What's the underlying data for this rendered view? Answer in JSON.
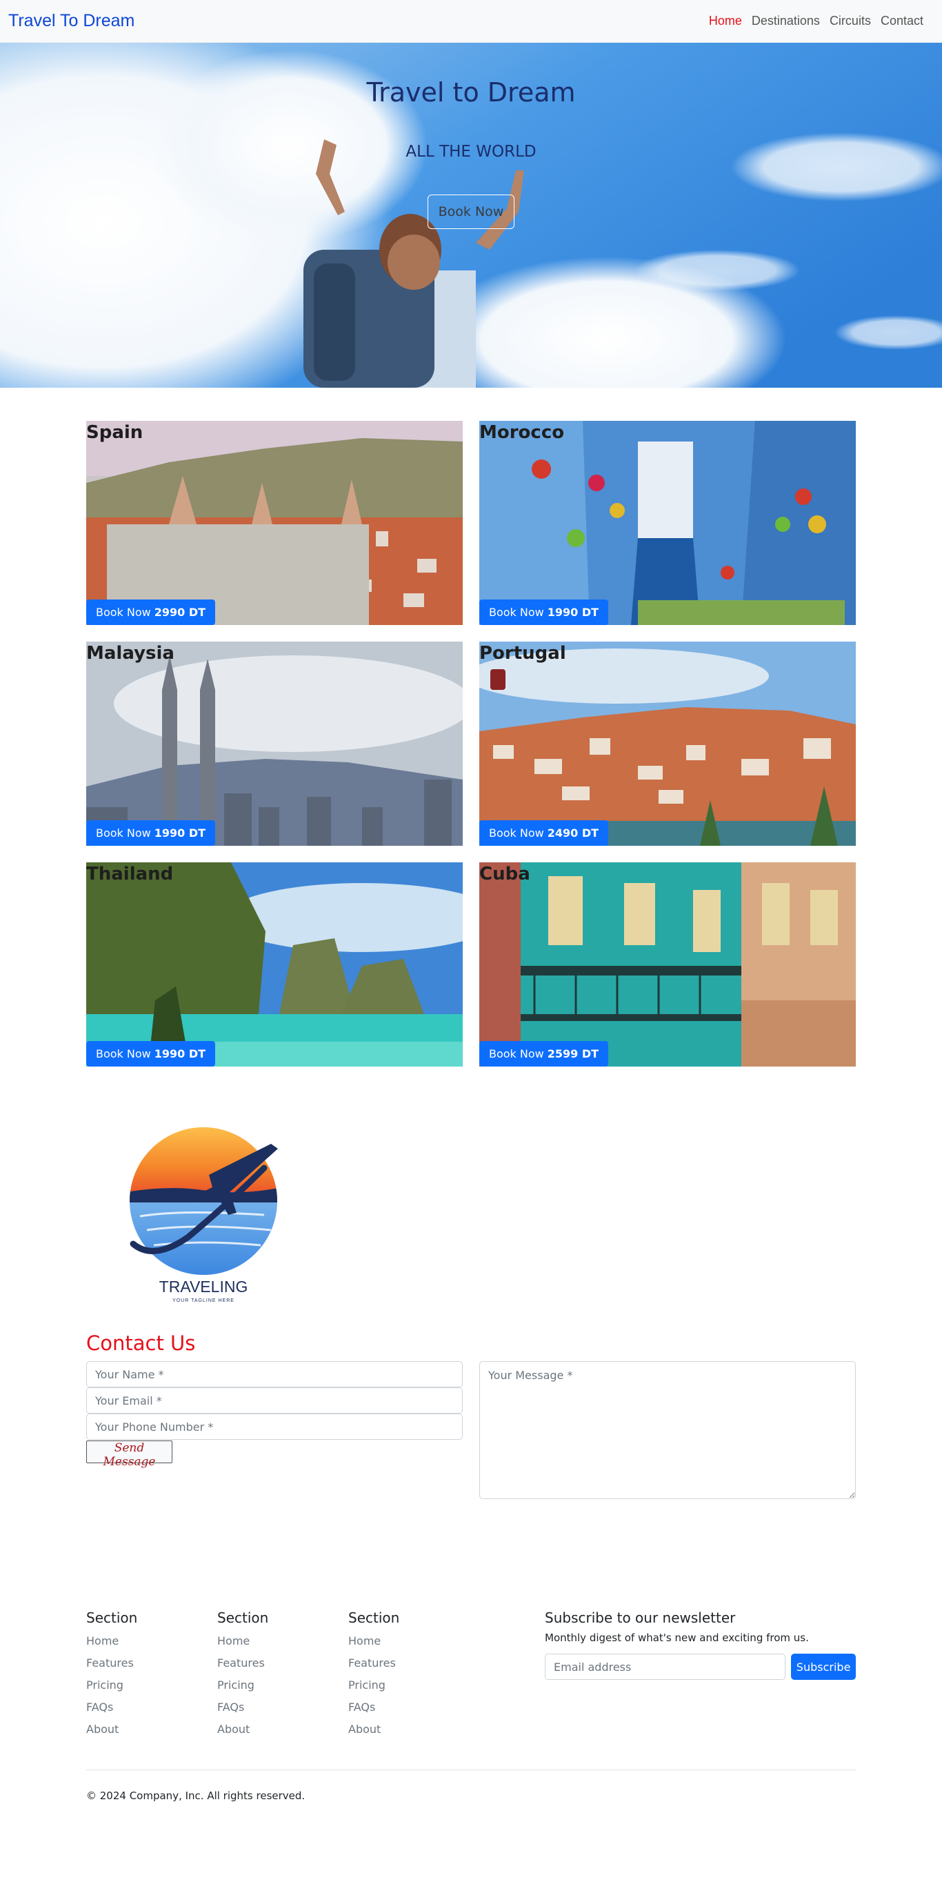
{
  "nav": {
    "brand": "Travel To Dream",
    "links": [
      "Home",
      "Destinations",
      "Circuits",
      "Contact"
    ]
  },
  "hero": {
    "title": "Travel to Dream",
    "subtitle": "ALL THE WORLD",
    "button": "Book Now"
  },
  "destinations": [
    {
      "name": "Spain",
      "book_label": "Book Now",
      "price": "2990 DT"
    },
    {
      "name": "Morocco",
      "book_label": "Book Now",
      "price": "1990 DT"
    },
    {
      "name": "Malaysia",
      "book_label": "Book Now",
      "price": "1990 DT"
    },
    {
      "name": "Portugal",
      "book_label": "Book Now",
      "price": "2490 DT"
    },
    {
      "name": "Thailand",
      "book_label": "Book Now",
      "price": "1990 DT"
    },
    {
      "name": "Cuba",
      "book_label": "Book Now",
      "price": "2599 DT"
    }
  ],
  "logo": {
    "text": "TRAVELING",
    "tagline": "YOUR TAGLINE HERE"
  },
  "contact": {
    "title": "Contact Us",
    "name_placeholder": "Your Name *",
    "email_placeholder": "Your Email *",
    "phone_placeholder": "Your Phone Number *",
    "message_placeholder": "Your Message *",
    "send_button": "Send Message"
  },
  "footer": {
    "columns": [
      {
        "heading": "Section",
        "links": [
          "Home",
          "Features",
          "Pricing",
          "FAQs",
          "About"
        ]
      },
      {
        "heading": "Section",
        "links": [
          "Home",
          "Features",
          "Pricing",
          "FAQs",
          "About"
        ]
      },
      {
        "heading": "Section",
        "links": [
          "Home",
          "Features",
          "Pricing",
          "FAQs",
          "About"
        ]
      }
    ],
    "newsletter": {
      "title": "Subscribe to our newsletter",
      "text": "Monthly digest of what's new and exciting from us.",
      "placeholder": "Email address",
      "button": "Subscribe"
    },
    "copyright": "© 2024 Company, Inc. All rights reserved."
  },
  "colors": {
    "brand": "#0d47d9",
    "accent_red": "#e8101a",
    "primary": "#0d6efd"
  }
}
